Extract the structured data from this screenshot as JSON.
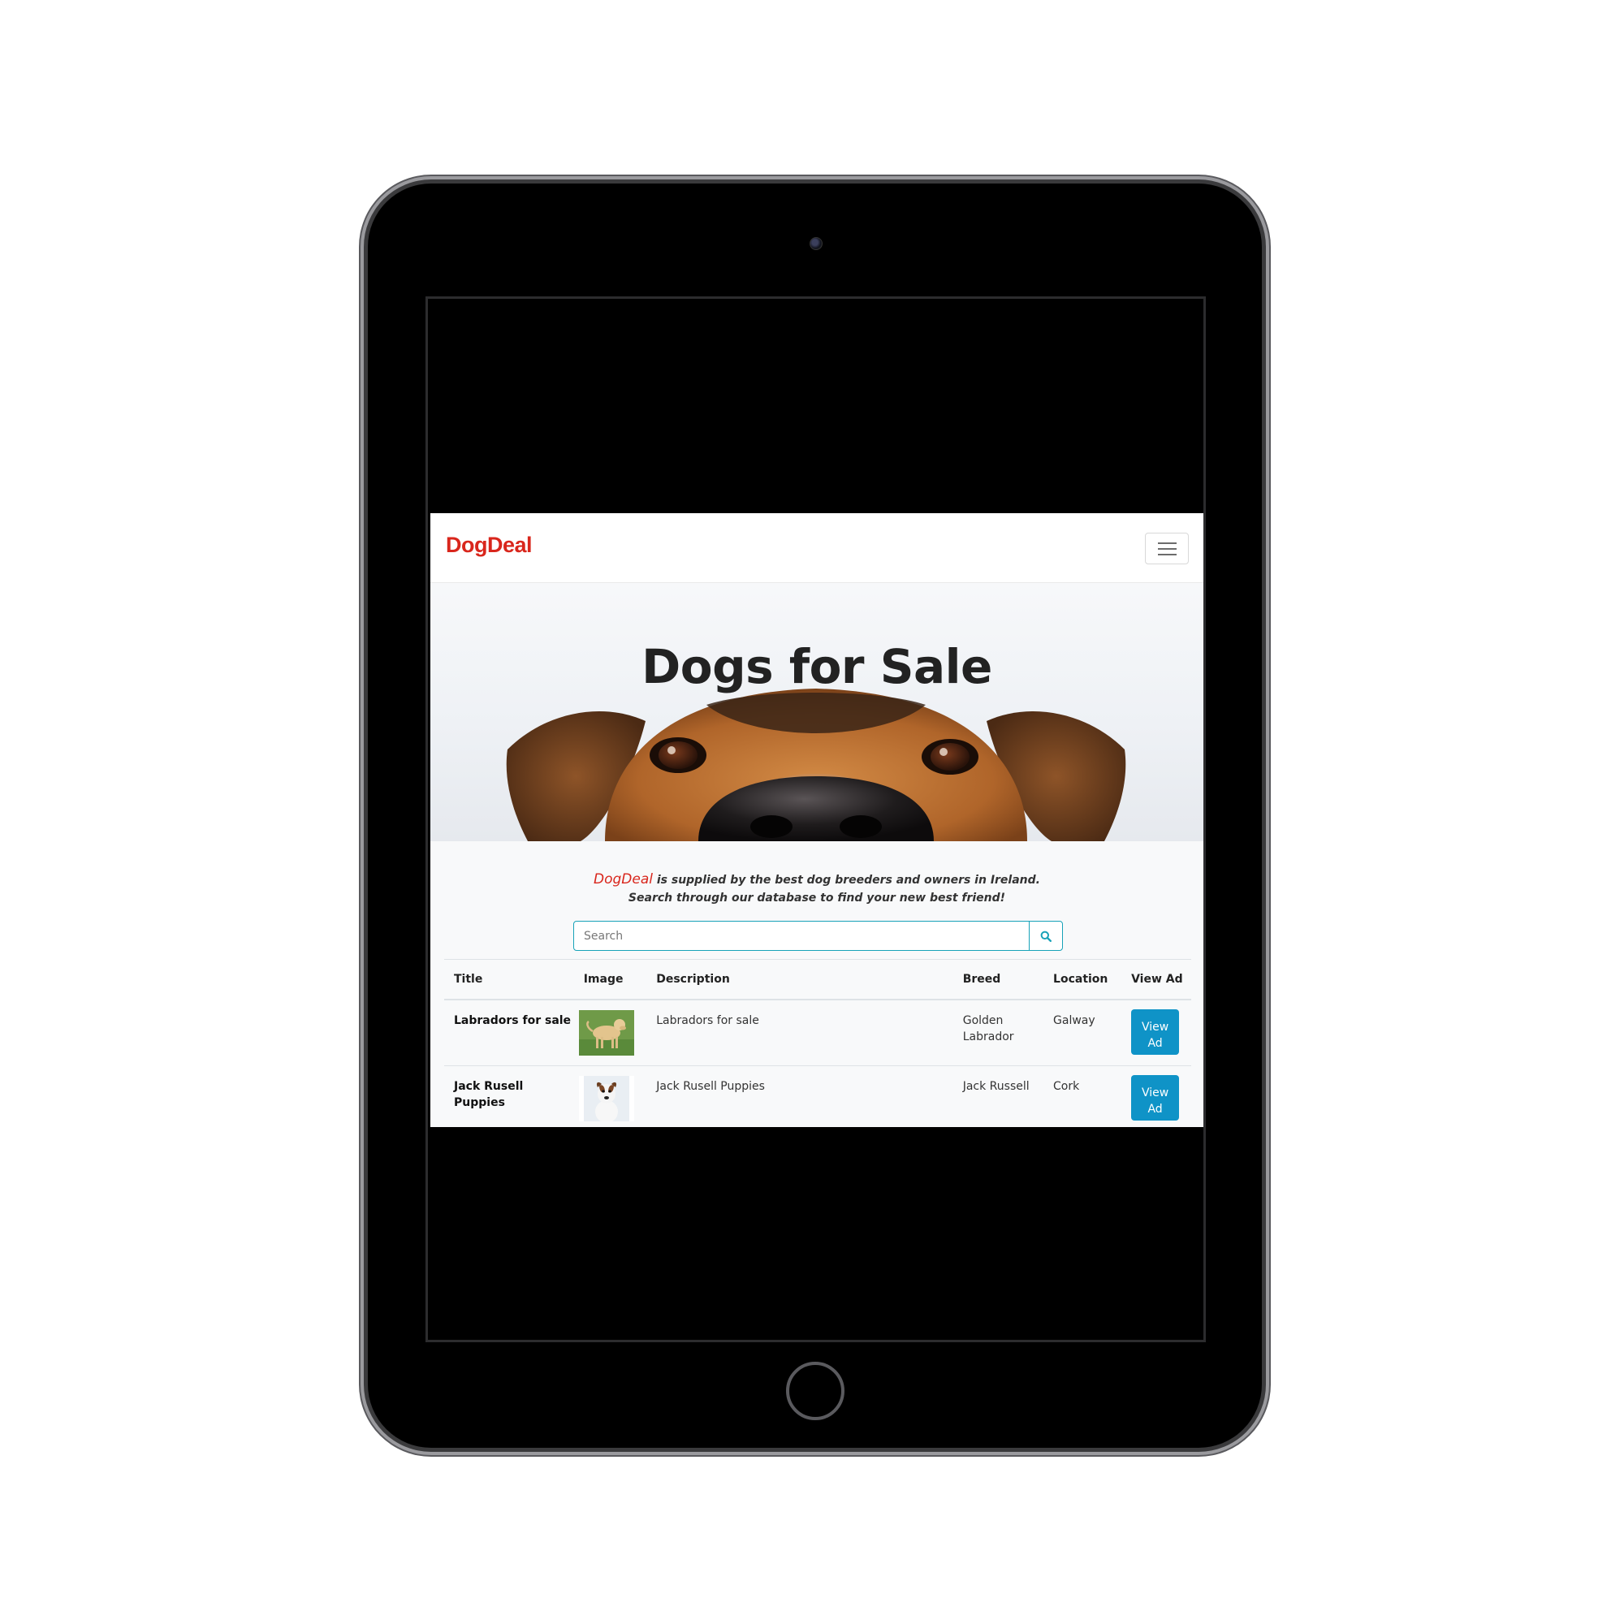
{
  "brand": "DogDeal",
  "menu_toggle_icon": "hamburger-icon",
  "hero": {
    "title": "Dogs for Sale"
  },
  "intro": {
    "brand": "DogDeal",
    "line1": " is supplied by the best dog breeders and owners in Ireland.",
    "line2": "Search through our database to find your new best friend!"
  },
  "search": {
    "placeholder": "Search",
    "button_icon": "search-icon"
  },
  "table": {
    "headers": [
      "Title",
      "Image",
      "Description",
      "Breed",
      "Location",
      "View Ad"
    ],
    "rows": [
      {
        "title": "Labradors for sale",
        "image": "labrador-thumbnail",
        "description": "Labradors for sale",
        "breed": "Golden Labrador",
        "location": "Galway",
        "button": "View Ad"
      },
      {
        "title": "Jack Rusell Puppies",
        "image": "jack-russell-thumbnail",
        "description": "Jack Rusell Puppies",
        "breed": "Jack Russell",
        "location": "Cork",
        "button": "View Ad"
      }
    ]
  },
  "colors": {
    "brand": "#d9261c",
    "button": "#0f93c7",
    "search_border": "#17a2b8"
  }
}
